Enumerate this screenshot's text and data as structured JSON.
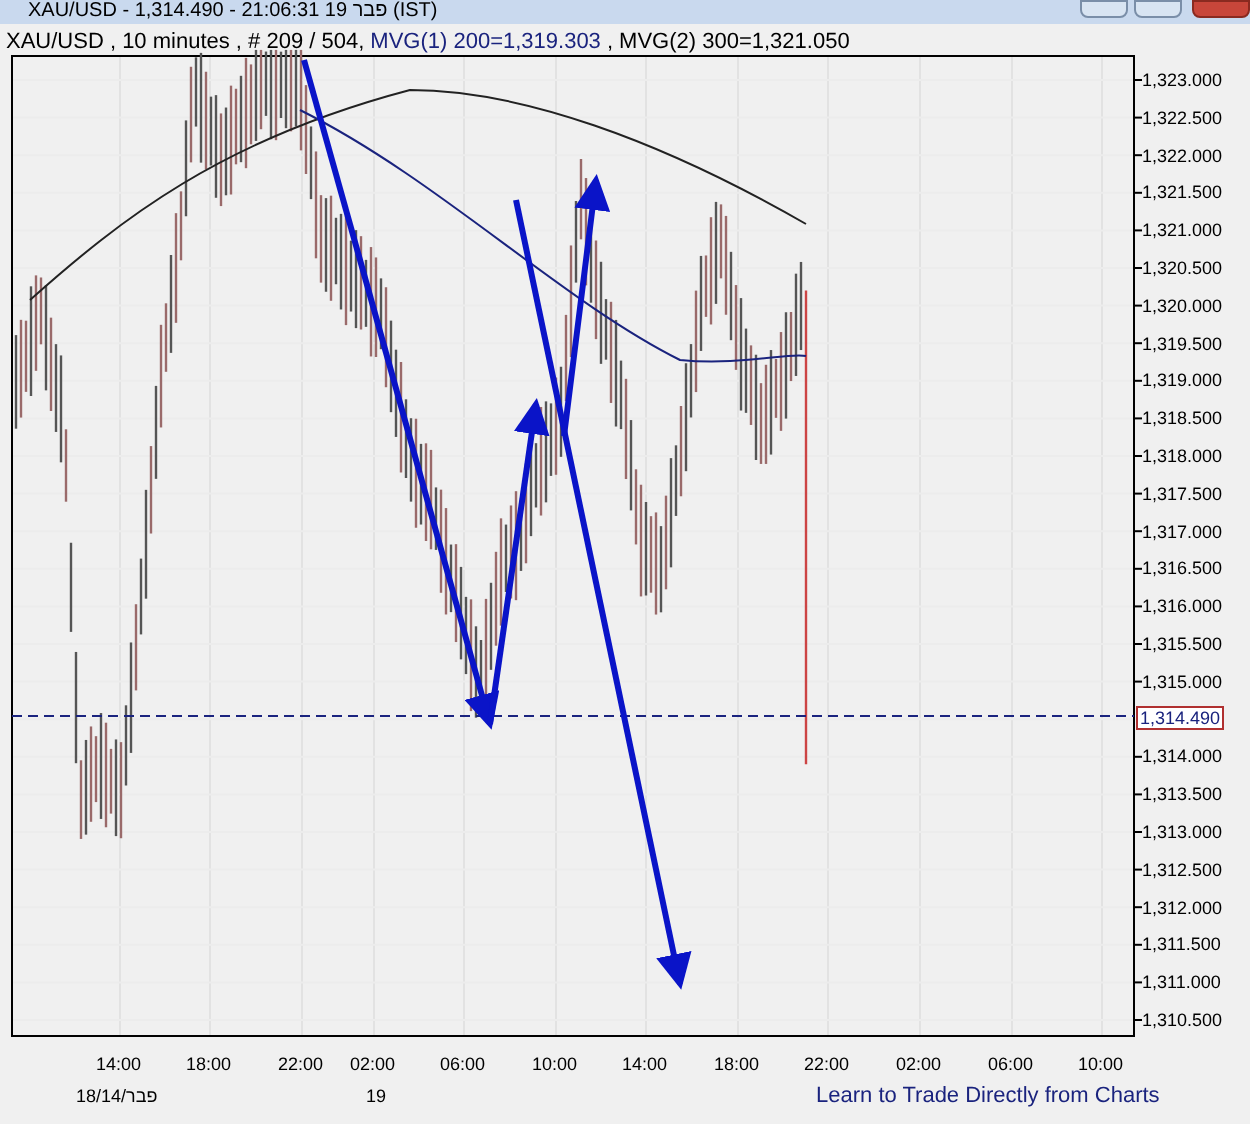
{
  "window": {
    "title": "XAU/USD - 1,314.490 - 21:06:31  19 פבר (IST)"
  },
  "chart": {
    "header": [
      {
        "kind": "plain",
        "text": "XAU/USD , 10 minutes , # 209 / 504,"
      },
      {
        "kind": "indicator",
        "text": "MVG(1) 200=1,319.303"
      },
      {
        "kind": "plain",
        "text": ", MVG(2) 300=1,321.050"
      }
    ],
    "price_labels": [
      "1,323.000",
      "1,322.500",
      "1,322.000",
      "1,321.500",
      "1,321.000",
      "1,320.500",
      "1,320.000",
      "1,319.500",
      "1,319.000",
      "1,318.500",
      "1,318.000",
      "1,317.500",
      "1,317.000",
      "1,316.500",
      "1,316.000",
      "1,315.500",
      "1,315.000",
      "1,314.000",
      "1,313.500",
      "1,313.000",
      "1,312.500",
      "1,312.000",
      "1,311.500",
      "1,311.000",
      "1,310.500"
    ],
    "current_price": "1,314.490",
    "time_labels": [
      "14:00",
      "18:00",
      "22:00",
      "02:00",
      "06:00",
      "10:00",
      "14:00",
      "18:00",
      "22:00",
      "02:00",
      "06:00",
      "10:00"
    ],
    "date_labels": [
      "18/14/פבר",
      "19"
    ],
    "link": "Learn to Trade Directly from Charts"
  }
}
